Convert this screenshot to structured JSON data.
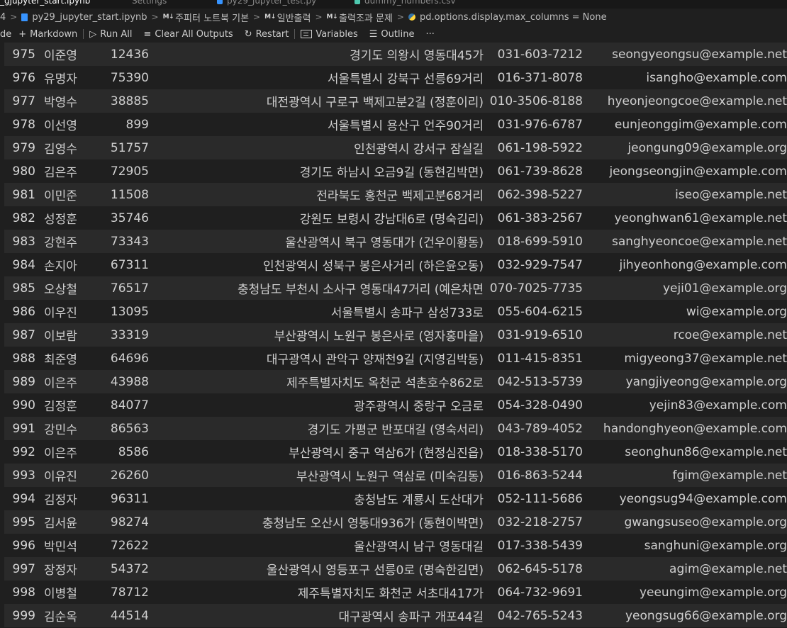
{
  "tabs": [
    {
      "label": "_gjupyter_start.ipynb",
      "active": true
    },
    {
      "label": "Settings",
      "active": false
    },
    {
      "label": "py29_jupyter_test.py",
      "active": false
    },
    {
      "label": "dummy_numbers.csv",
      "active": false
    }
  ],
  "breadcrumb": {
    "prefix": "4",
    "file": "py29_jupyter_start.ipynb",
    "md_badge": "M↓",
    "section1": "주피터 노트북 기본",
    "section2": "일반출력",
    "section3": "출력조과 문제",
    "cell": "pd.options.display.max_columns = None"
  },
  "toolbar": {
    "code_label": "de",
    "markdown_label": "Markdown",
    "run_all_label": "Run All",
    "clear_label": "Clear All Outputs",
    "restart_label": "Restart",
    "variables_label": "Variables",
    "outline_label": "Outline",
    "more_label": "···"
  },
  "rows": [
    {
      "idx": "975",
      "name": "이준영",
      "zip": "12436",
      "addr": "경기도 의왕시 영동대45가",
      "phone": "031-603-7212",
      "email": "seongyeongsu@example.net"
    },
    {
      "idx": "976",
      "name": "유명자",
      "zip": "75390",
      "addr": "서울특별시 강북구 선릉69거리",
      "phone": "016-371-8078",
      "email": "isangho@example.com"
    },
    {
      "idx": "977",
      "name": "박영수",
      "zip": "38885",
      "addr": "대전광역시 구로구 백제고분2길 (정훈이리)",
      "phone": "010-3506-8188",
      "email": "hyeonjeongcoe@example.net"
    },
    {
      "idx": "978",
      "name": "이선영",
      "zip": "899",
      "addr": "서울특별시 용산구 언주90거리",
      "phone": "031-976-6787",
      "email": "eunjeonggim@example.com"
    },
    {
      "idx": "979",
      "name": "김영수",
      "zip": "51757",
      "addr": "인천광역시 강서구 잠실길",
      "phone": "061-198-5922",
      "email": "jeongung09@example.org"
    },
    {
      "idx": "980",
      "name": "김은주",
      "zip": "72905",
      "addr": "경기도 하남시 오금9길 (동현김박면)",
      "phone": "061-739-8628",
      "email": "jeongseongjin@example.com"
    },
    {
      "idx": "981",
      "name": "이민준",
      "zip": "11508",
      "addr": "전라북도 홍천군 백제고분68거리",
      "phone": "062-398-5227",
      "email": "iseo@example.net"
    },
    {
      "idx": "982",
      "name": "성정훈",
      "zip": "35746",
      "addr": "강원도 보령시 강남대6로 (명숙김리)",
      "phone": "061-383-2567",
      "email": "yeonghwan61@example.net"
    },
    {
      "idx": "983",
      "name": "강현주",
      "zip": "73343",
      "addr": "울산광역시 북구 영동대가 (건우이황동)",
      "phone": "018-699-5910",
      "email": "sanghyeoncoe@example.net"
    },
    {
      "idx": "984",
      "name": "손지아",
      "zip": "67311",
      "addr": "인천광역시 성북구 봉은사거리 (하은윤오동)",
      "phone": "032-929-7547",
      "email": "jihyeonhong@example.com"
    },
    {
      "idx": "985",
      "name": "오상철",
      "zip": "76517",
      "addr": "충청남도 부천시 소사구 영동대47거리 (예은차면",
      "phone": "070-7025-7735",
      "email": "yeji01@example.org"
    },
    {
      "idx": "986",
      "name": "이우진",
      "zip": "13095",
      "addr": "서울특별시 송파구 삼성733로",
      "phone": "055-604-6215",
      "email": "wi@example.org"
    },
    {
      "idx": "987",
      "name": "이보람",
      "zip": "33319",
      "addr": "부산광역시 노원구 봉은사로 (영자홍마을)",
      "phone": "031-919-6510",
      "email": "rcoe@example.net"
    },
    {
      "idx": "988",
      "name": "최준영",
      "zip": "64696",
      "addr": "대구광역시 관악구 양재천9길 (지영김박동)",
      "phone": "011-415-8351",
      "email": "migyeong37@example.net"
    },
    {
      "idx": "989",
      "name": "이은주",
      "zip": "43988",
      "addr": "제주특별자치도 옥천군 석촌호수862로",
      "phone": "042-513-5739",
      "email": "yangjiyeong@example.org"
    },
    {
      "idx": "990",
      "name": "김정훈",
      "zip": "84077",
      "addr": "광주광역시 중랑구 오금로",
      "phone": "054-328-0490",
      "email": "yejin83@example.com"
    },
    {
      "idx": "991",
      "name": "강민수",
      "zip": "86563",
      "addr": "경기도 가평군 반포대길 (영숙서리)",
      "phone": "043-789-4052",
      "email": "handonghyeon@example.com"
    },
    {
      "idx": "992",
      "name": "이은주",
      "zip": "8586",
      "addr": "부산광역시 중구 역삼6가 (현정심진읍)",
      "phone": "018-338-5170",
      "email": "seonghun86@example.net"
    },
    {
      "idx": "993",
      "name": "이유진",
      "zip": "26260",
      "addr": "부산광역시 노원구 역삼로 (미숙김동)",
      "phone": "016-863-5244",
      "email": "fgim@example.net"
    },
    {
      "idx": "994",
      "name": "김정자",
      "zip": "96311",
      "addr": "충청남도 계룡시 도산대가",
      "phone": "052-111-5686",
      "email": "yeongsug94@example.com"
    },
    {
      "idx": "995",
      "name": "김서윤",
      "zip": "98274",
      "addr": "충청남도 오산시 영동대936가 (동현이박면)",
      "phone": "032-218-2757",
      "email": "gwangsuseo@example.org"
    },
    {
      "idx": "996",
      "name": "박민석",
      "zip": "72622",
      "addr": "울산광역시 남구 영동대길",
      "phone": "017-338-5439",
      "email": "sanghuni@example.org"
    },
    {
      "idx": "997",
      "name": "장정자",
      "zip": "54372",
      "addr": "울산광역시 영등포구 선릉0로 (명숙한김면)",
      "phone": "062-645-5178",
      "email": "agim@example.net"
    },
    {
      "idx": "998",
      "name": "이병철",
      "zip": "78712",
      "addr": "제주특별자치도 화천군 서초대417가",
      "phone": "064-732-9691",
      "email": "yeeungim@example.org"
    },
    {
      "idx": "999",
      "name": "김순옥",
      "zip": "44514",
      "addr": "대구광역시 송파구 개포44길",
      "phone": "042-765-5243",
      "email": "yeongsug66@example.org"
    }
  ]
}
